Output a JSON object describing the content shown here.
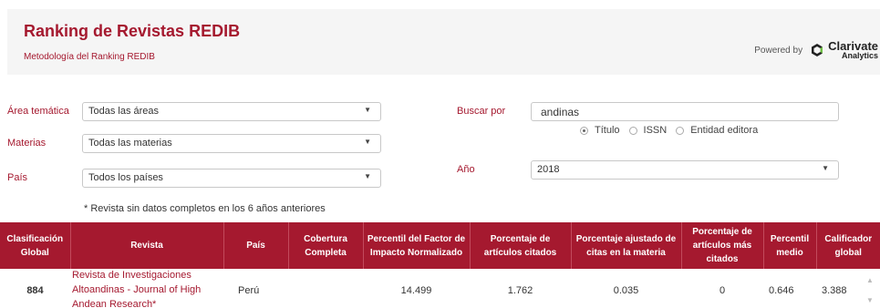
{
  "header": {
    "title": "Ranking de Revistas REDIB",
    "methodology_link": "Metodología del Ranking REDIB",
    "powered_by": "Powered by",
    "brand_name": "Clarivate",
    "brand_sub": "Analytics"
  },
  "filters": {
    "area": {
      "label": "Área temática",
      "value": "Todas las áreas"
    },
    "subject": {
      "label": "Materias",
      "value": "Todas las materias"
    },
    "country": {
      "label": "País",
      "value": "Todos los países"
    },
    "search": {
      "label": "Buscar por",
      "value": "andinas"
    },
    "search_by": [
      {
        "label": "Título",
        "checked": true
      },
      {
        "label": "ISSN",
        "checked": false
      },
      {
        "label": "Entidad editora",
        "checked": false
      }
    ],
    "year": {
      "label": "Año",
      "value": "2018"
    }
  },
  "note": "* Revista sin datos completos en los 6 años anteriores",
  "table": {
    "headers": [
      "Clasificación Global",
      "Revista",
      "País",
      "Cobertura Completa",
      "Percentil del Factor de Impacto Normalizado",
      "Porcentaje de artículos citados",
      "Porcentaje ajustado de citas en la materia",
      "Porcentaje de artículos más citados",
      "Percentil medio",
      "Calificador global"
    ],
    "rows": [
      {
        "rank": "884",
        "journal": "Revista de Investigaciones Altoandinas - Journal of High Andean Research*",
        "country": "Perú",
        "coverage": "",
        "impact_percentile": "14.499",
        "cited_pct": "1.762",
        "adjusted_citations": "0.035",
        "most_cited_pct": "0",
        "mean_percentile": "0.646",
        "global_score": "3.388"
      }
    ]
  },
  "colors": {
    "brand": "#a5192f",
    "header_bg": "#f5f5f5"
  }
}
